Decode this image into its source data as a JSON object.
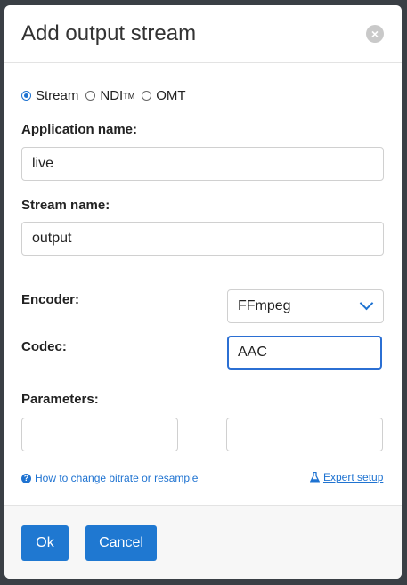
{
  "dialog": {
    "title": "Add output stream",
    "close_icon": "close-icon"
  },
  "source_type": {
    "options": [
      {
        "label": "Stream",
        "checked": true
      },
      {
        "label": "NDI",
        "sup": "TM",
        "checked": false
      },
      {
        "label": "OMT",
        "checked": false
      }
    ]
  },
  "application": {
    "label": "Application name:",
    "value": "live"
  },
  "stream": {
    "label": "Stream name:",
    "value": "output"
  },
  "encoder": {
    "label": "Encoder:",
    "value": "FFmpeg"
  },
  "codec": {
    "label": "Codec:",
    "value": "AAC"
  },
  "parameters": {
    "label": "Parameters:",
    "value1": "",
    "value2": ""
  },
  "links": {
    "help": "How to change bitrate or resample",
    "expert": "Expert setup"
  },
  "footer": {
    "ok_label": "Ok",
    "cancel_label": "Cancel"
  },
  "colors": {
    "accent": "#1f78d1",
    "overlay": "#3a3f45"
  }
}
